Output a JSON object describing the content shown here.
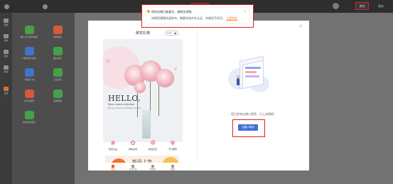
{
  "topbar": {
    "left_item_1": "",
    "left_item_2": "",
    "publish_label": "发布",
    "save_label": "保存"
  },
  "notice": {
    "line1": "您的店铺已被激活，请前往续期。",
    "line2": "如果您想要快速发布，需要完成实名认证，并绑定手机号。",
    "link": "立即前往"
  },
  "leftnav": [
    "页面",
    "模块",
    "组件",
    "素材",
    "设置"
  ],
  "templates": [
    {
      "label": "图片文字组件模板",
      "color": "#46a047"
    },
    {
      "label": "视频组件",
      "color": "#d65a3a"
    },
    {
      "label": "小程序客户展示",
      "color": "#3f74c9"
    },
    {
      "label": "图片展示",
      "color": "#46a047"
    },
    {
      "label": "小程序广告",
      "color": "#3f74c9"
    },
    {
      "label": "门店列表",
      "color": "#46a047"
    },
    {
      "label": "分享类组件",
      "color": "#d65a3a"
    },
    {
      "label": "店铺导航",
      "color": "#46a047"
    },
    {
      "label": "营销活动组件",
      "color": "#46a047"
    }
  ],
  "phone": {
    "title": "鲜花礼物",
    "ctrl_more": "•••",
    "ctrl_close": "◉",
    "hero_hello": "HELLO,",
    "hero_sub": "Rose mood collection",
    "hero_sub2": "Bring a bloom of flowers to life",
    "categories": [
      {
        "icon": "❀",
        "label": "鲜花礼盒"
      },
      {
        "icon": "✿",
        "label": "绿植多肉"
      },
      {
        "icon": "❁",
        "label": "精选花束"
      },
      {
        "icon": "✾",
        "label": "节日推荐"
      }
    ],
    "banner_text": "新品上市",
    "tabs": [
      {
        "label": "首页",
        "active": true
      },
      {
        "label": "全部产品",
        "active": false
      },
      {
        "label": "购物车",
        "active": false
      },
      {
        "label": "我的",
        "active": false
      }
    ]
  },
  "modal": {
    "close": "×",
    "prompt": "您已经有店铺小程序，马上创建吧！",
    "create_button": "创建小程序"
  }
}
